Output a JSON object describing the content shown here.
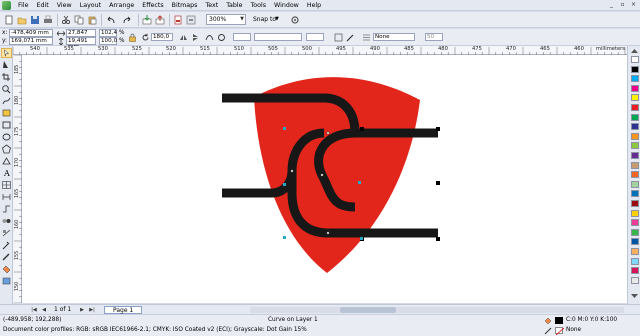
{
  "menubar": {
    "items": [
      "File",
      "Edit",
      "View",
      "Layout",
      "Arrange",
      "Effects",
      "Bitmaps",
      "Text",
      "Table",
      "Tools",
      "Window",
      "Help"
    ],
    "window_controls": [
      "_",
      "▫",
      "×"
    ]
  },
  "toolbar": {
    "zoom_value": "300%",
    "snap_label": "Snap to"
  },
  "propbar": {
    "x_label": "x:",
    "x_value": "-478,409 mm",
    "y_label": "y:",
    "y_value": "169,071 mm",
    "w_value": "27,847 mm",
    "h_value": "19,491 mm",
    "scale_x": "102,4",
    "scale_y": "100,0",
    "pct": "%",
    "angle_value": "180,0",
    "outline_width": "None",
    "number_value": "50"
  },
  "ruler": {
    "h_ticks": [
      "540",
      "535",
      "530",
      "525",
      "520",
      "515",
      "510",
      "505",
      "500",
      "495",
      "490",
      "485",
      "480",
      "475",
      "470",
      "465",
      "460",
      "455"
    ],
    "unit": "millimeters",
    "v_ticks": [
      "185",
      "180",
      "175",
      "170",
      "165",
      "160",
      "155",
      "150"
    ]
  },
  "pagenav": {
    "page_count": "1 of 1",
    "page_tab": "Page 1"
  },
  "status": {
    "cursor_coords": "(-489,958; 192,288)",
    "object_info": "Curve on Layer 1",
    "color_profiles": "Document color profiles: RGB: sRGB IEC61966-2.1; CMYK: ISO Coated v2 (ECI); Grayscale: Dot Gain 15%",
    "fill_info": "C:0 M:0 Y:0 K:100",
    "outline_info": "None"
  },
  "colors": {
    "shield_red": "#e2261b",
    "stroke_black": "#171717",
    "node_blue": "#2aa8c8",
    "palette": [
      "#ffffff",
      "#000000",
      "#00aeef",
      "#ec008c",
      "#fff200",
      "#ed1c24",
      "#00a651",
      "#2e3192",
      "#f7941d",
      "#8dc63f",
      "#662d91",
      "#c69c6d",
      "#f26522",
      "#a3d39c",
      "#0072bc",
      "#9e0b0f",
      "#ffd200",
      "#ee3c96",
      "#39b54a",
      "#0054a6",
      "#fbaf5d",
      "#7fd8f7",
      "#d4145a",
      "#e8e8e8"
    ]
  }
}
